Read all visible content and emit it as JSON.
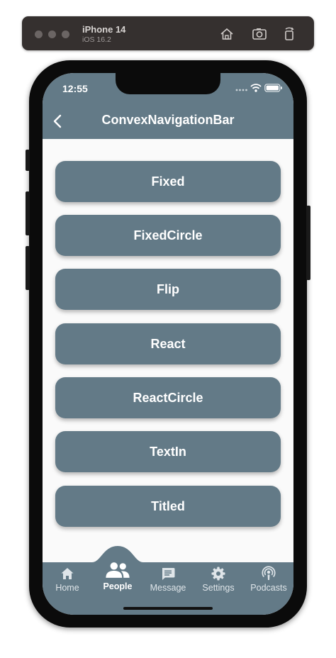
{
  "simulator": {
    "device_name": "iPhone 14",
    "os_version": "iOS 16.2"
  },
  "status_bar": {
    "time": "12:55"
  },
  "app_bar": {
    "title": "ConvexNavigationBar"
  },
  "buttons": [
    "Fixed",
    "FixedCircle",
    "Flip",
    "React",
    "ReactCircle",
    "TextIn",
    "Titled"
  ],
  "tabs": [
    {
      "label": "Home",
      "icon": "home-icon",
      "active": false
    },
    {
      "label": "People",
      "icon": "people-icon",
      "active": true
    },
    {
      "label": "Message",
      "icon": "message-icon",
      "active": false
    },
    {
      "label": "Settings",
      "icon": "gear-icon",
      "active": false
    },
    {
      "label": "Podcasts",
      "icon": "podcasts-icon",
      "active": false
    }
  ],
  "colors": {
    "primary": "#637a87",
    "background": "#fafafa",
    "on_primary": "#ffffff"
  }
}
